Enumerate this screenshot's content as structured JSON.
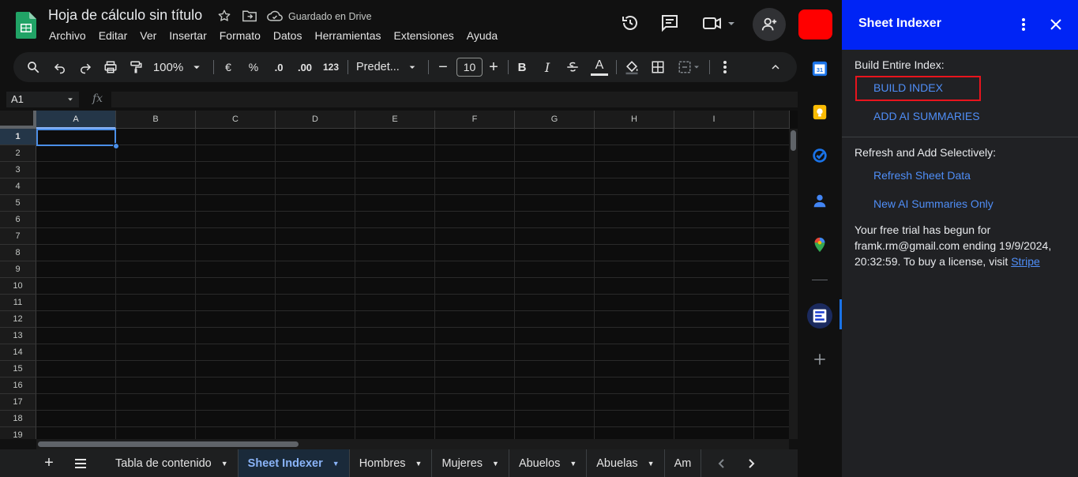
{
  "header": {
    "title": "Hoja de cálculo sin título",
    "saved_status": "Guardado en Drive",
    "menu": [
      "Archivo",
      "Editar",
      "Ver",
      "Insertar",
      "Formato",
      "Datos",
      "Herramientas",
      "Extensiones",
      "Ayuda"
    ]
  },
  "toolbar": {
    "zoom": "100%",
    "currency": "€",
    "percent": "%",
    "dec_decrease": ".0",
    "dec_increase": ".00",
    "number_format": "123",
    "font": "Predet...",
    "font_size": "10",
    "bold": "B",
    "italic": "I",
    "text_color": "A"
  },
  "formula_bar": {
    "cell_ref": "A1",
    "fx": "fx"
  },
  "grid": {
    "columns": [
      "A",
      "B",
      "C",
      "D",
      "E",
      "F",
      "G",
      "H",
      "I"
    ],
    "rows": [
      "1",
      "2",
      "3",
      "4",
      "5",
      "6",
      "7",
      "8",
      "9",
      "10",
      "11",
      "12",
      "13",
      "14",
      "15",
      "16",
      "17",
      "18",
      "19"
    ],
    "selected_cell": "A1"
  },
  "sheet_tabs": [
    {
      "label": "Tabla de contenido",
      "active": false
    },
    {
      "label": "Sheet Indexer",
      "active": true
    },
    {
      "label": "Hombres",
      "active": false
    },
    {
      "label": "Mujeres",
      "active": false
    },
    {
      "label": "Abuelos",
      "active": false
    },
    {
      "label": "Abuelas",
      "active": false
    },
    {
      "label": "Am",
      "active": false
    }
  ],
  "side_rail": {
    "icons": [
      "calendar-icon",
      "keep-icon",
      "tasks-icon",
      "contacts-icon",
      "maps-icon",
      "sheet-indexer-addon-icon",
      "add-icon"
    ],
    "calendar_day": "31"
  },
  "panel": {
    "title": "Sheet Indexer",
    "section1_label": "Build Entire Index:",
    "build_index": "BUILD INDEX",
    "add_ai_summaries": "ADD AI SUMMARIES",
    "section2_label": "Refresh and Add Selectively:",
    "refresh_sheet_data": "Refresh Sheet Data",
    "new_ai_summaries": "New AI Summaries Only",
    "trial_text": "Your free trial has begun for framk.rm@gmail.com ending 19/9/2024, 20:32:59. To buy a license, visit",
    "trial_link": "Stripe"
  },
  "colors": {
    "panel_header": "#0024f5",
    "link": "#4f8ef7",
    "highlight": "#e8141d",
    "active_tab": "#8ab4f8",
    "red_block": "#ff0000"
  }
}
